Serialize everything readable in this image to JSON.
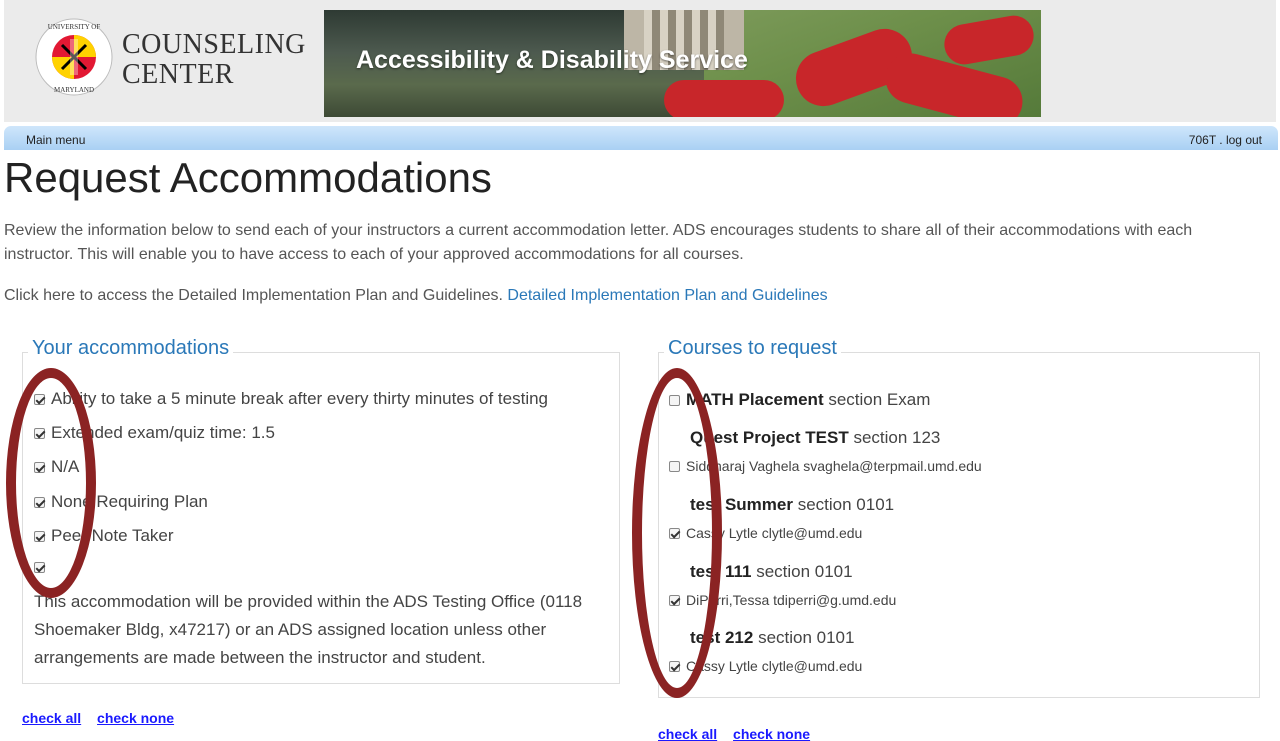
{
  "header": {
    "logo_line1": "COUNSELING",
    "logo_line2": "CENTER",
    "banner_title": "Accessibility & Disability Service",
    "logo_ring_top": "UNIVERSITY OF",
    "logo_ring_bottom": "MARYLAND"
  },
  "menubar": {
    "main_menu": "Main menu",
    "user": "706T",
    "separator": ".",
    "logout": "log out"
  },
  "page": {
    "title": "Request Accommodations",
    "intro": "Review the information below to send each of your instructors a current accommodation letter. ADS encourages students to share all of their accommodations with each instructor. This will enable you to have access to each of your approved accommodations for all courses.",
    "click_text": "Click here to access the Detailed Implementation Plan and Guidelines.",
    "click_link": "Detailed Implementation Plan and Guidelines"
  },
  "accommodations": {
    "title": "Your accommodations",
    "items": [
      {
        "label": "Ability to take a 5 minute break after every thirty minutes of testing",
        "checked": true
      },
      {
        "label": "Extended exam/quiz time: 1.5",
        "checked": true
      },
      {
        "label": "N/A",
        "checked": true
      },
      {
        "label": "None Requiring Plan",
        "checked": true
      },
      {
        "label": "Peer Note Taker",
        "checked": true
      },
      {
        "label": "",
        "checked": true
      }
    ],
    "note": "This accommodation will be provided within the ADS Testing Office (0118 Shoemaker Bldg, x47217) or an ADS assigned location unless other arrangements are made between the instructor and student.",
    "check_all": "check all",
    "check_none": "check none"
  },
  "courses": {
    "title": "Courses to request",
    "items": [
      {
        "course": "MATH Placement",
        "section_text": "section Exam",
        "instructor": null,
        "checked": false
      },
      {
        "course": "Quest Project TEST",
        "section_text": "section 123",
        "instructor": "Siddharaj Vaghela svaghela@terpmail.umd.edu",
        "checked": false
      },
      {
        "course": "test Summer",
        "section_text": "section 0101",
        "instructor": "Cassy Lytle clytle@umd.edu",
        "checked": true
      },
      {
        "course": "test 111",
        "section_text": "section 0101",
        "instructor": "DiPerri,Tessa tdiperri@g.umd.edu",
        "checked": true
      },
      {
        "course": "test 212",
        "section_text": "section 0101",
        "instructor": "Cassy Lytle clytle@umd.edu",
        "checked": true
      }
    ],
    "check_all": "check all",
    "check_none": "check none"
  },
  "colors": {
    "link": "#2a78b8",
    "annotation": "#8b2323",
    "menubar": "#a9d0f3"
  }
}
